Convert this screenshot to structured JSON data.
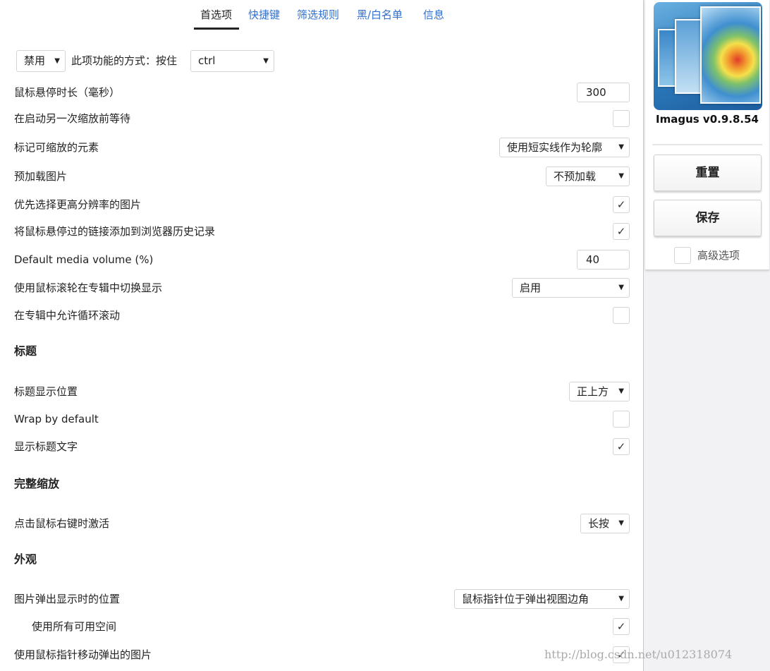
{
  "tabs": [
    {
      "label": "首选项"
    },
    {
      "label": "快捷键"
    },
    {
      "label": "筛选规则"
    },
    {
      "label": "黑/白名单"
    },
    {
      "label": "信息"
    }
  ],
  "activation": {
    "mode": "禁用",
    "text": "此项功能的方式：按住",
    "key": "ctrl"
  },
  "settings": [
    {
      "label": "鼠标悬停时长（毫秒）",
      "value": "300"
    },
    {
      "label": "在启动另一次缩放前等待",
      "checked": false
    },
    {
      "label": "标记可缩放的元素",
      "value": "使用短实线作为轮廓"
    },
    {
      "label": "预加载图片",
      "value": "不预加载"
    },
    {
      "label": "优先选择更高分辨率的图片",
      "checked": true
    },
    {
      "label": "将鼠标悬停过的链接添加到浏览器历史记录",
      "checked": true
    },
    {
      "label": "Default media volume (%)",
      "value": "40"
    },
    {
      "label": "使用鼠标滚轮在专辑中切换显示",
      "value": "启用"
    },
    {
      "label": "在专辑中允许循环滚动",
      "checked": false
    }
  ],
  "sections": {
    "caption": "标题",
    "zoom": "完整缩放",
    "appearance": "外观"
  },
  "caption_settings": [
    {
      "label": "标题显示位置",
      "value": "正上方"
    },
    {
      "label": "Wrap by default",
      "checked": false
    },
    {
      "label": "显示标题文字",
      "checked": true
    }
  ],
  "zoom_settings": [
    {
      "label": "点击鼠标右键时激活",
      "value": "长按"
    }
  ],
  "appearance_settings": [
    {
      "label": "图片弹出显示时的位置",
      "value": "鼠标指针位于弹出视图边角"
    },
    {
      "label": "使用所有可用空间",
      "checked": true
    },
    {
      "label": "使用鼠标指针移动弹出的图片",
      "checked": true
    }
  ],
  "sidebar": {
    "version": "Imagus v0.9.8.54",
    "reset_label": "重置",
    "save_label": "保存",
    "advanced_label": "高级选项"
  },
  "icons": {
    "check": "✓",
    "dropdown": "▼"
  },
  "watermark": "http://blog.csdn.net/u012318074"
}
